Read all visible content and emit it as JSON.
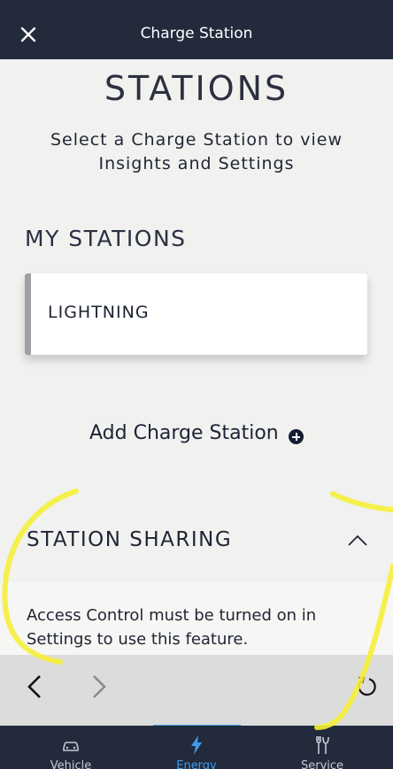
{
  "header": {
    "title": "Charge Station",
    "close_icon": "close-icon"
  },
  "main": {
    "heading": "STATIONS",
    "subtitle": "Select a Charge Station to view Insights and Settings",
    "my_stations_label": "MY STATIONS",
    "stations": [
      {
        "name": "LIGHTNING"
      }
    ],
    "add_station_label": "Add Charge Station"
  },
  "station_sharing": {
    "label": "STATION SHARING",
    "expanded": true,
    "message": "Access Control must be turned on in Settings to use this feature."
  },
  "browser_bar": {
    "icons": [
      "back-arrow-icon",
      "forward-arrow-icon",
      "reload-icon"
    ]
  },
  "bottom_nav": {
    "tabs": [
      {
        "label": "Vehicle",
        "icon": "car-icon",
        "active": false
      },
      {
        "label": "Energy",
        "icon": "lightning-icon",
        "active": true
      },
      {
        "label": "Service",
        "icon": "tools-icon",
        "active": false
      }
    ]
  },
  "colors": {
    "header_bg": "#232a3b",
    "accent": "#3c9df0",
    "annotation": "#f5ef3a"
  }
}
